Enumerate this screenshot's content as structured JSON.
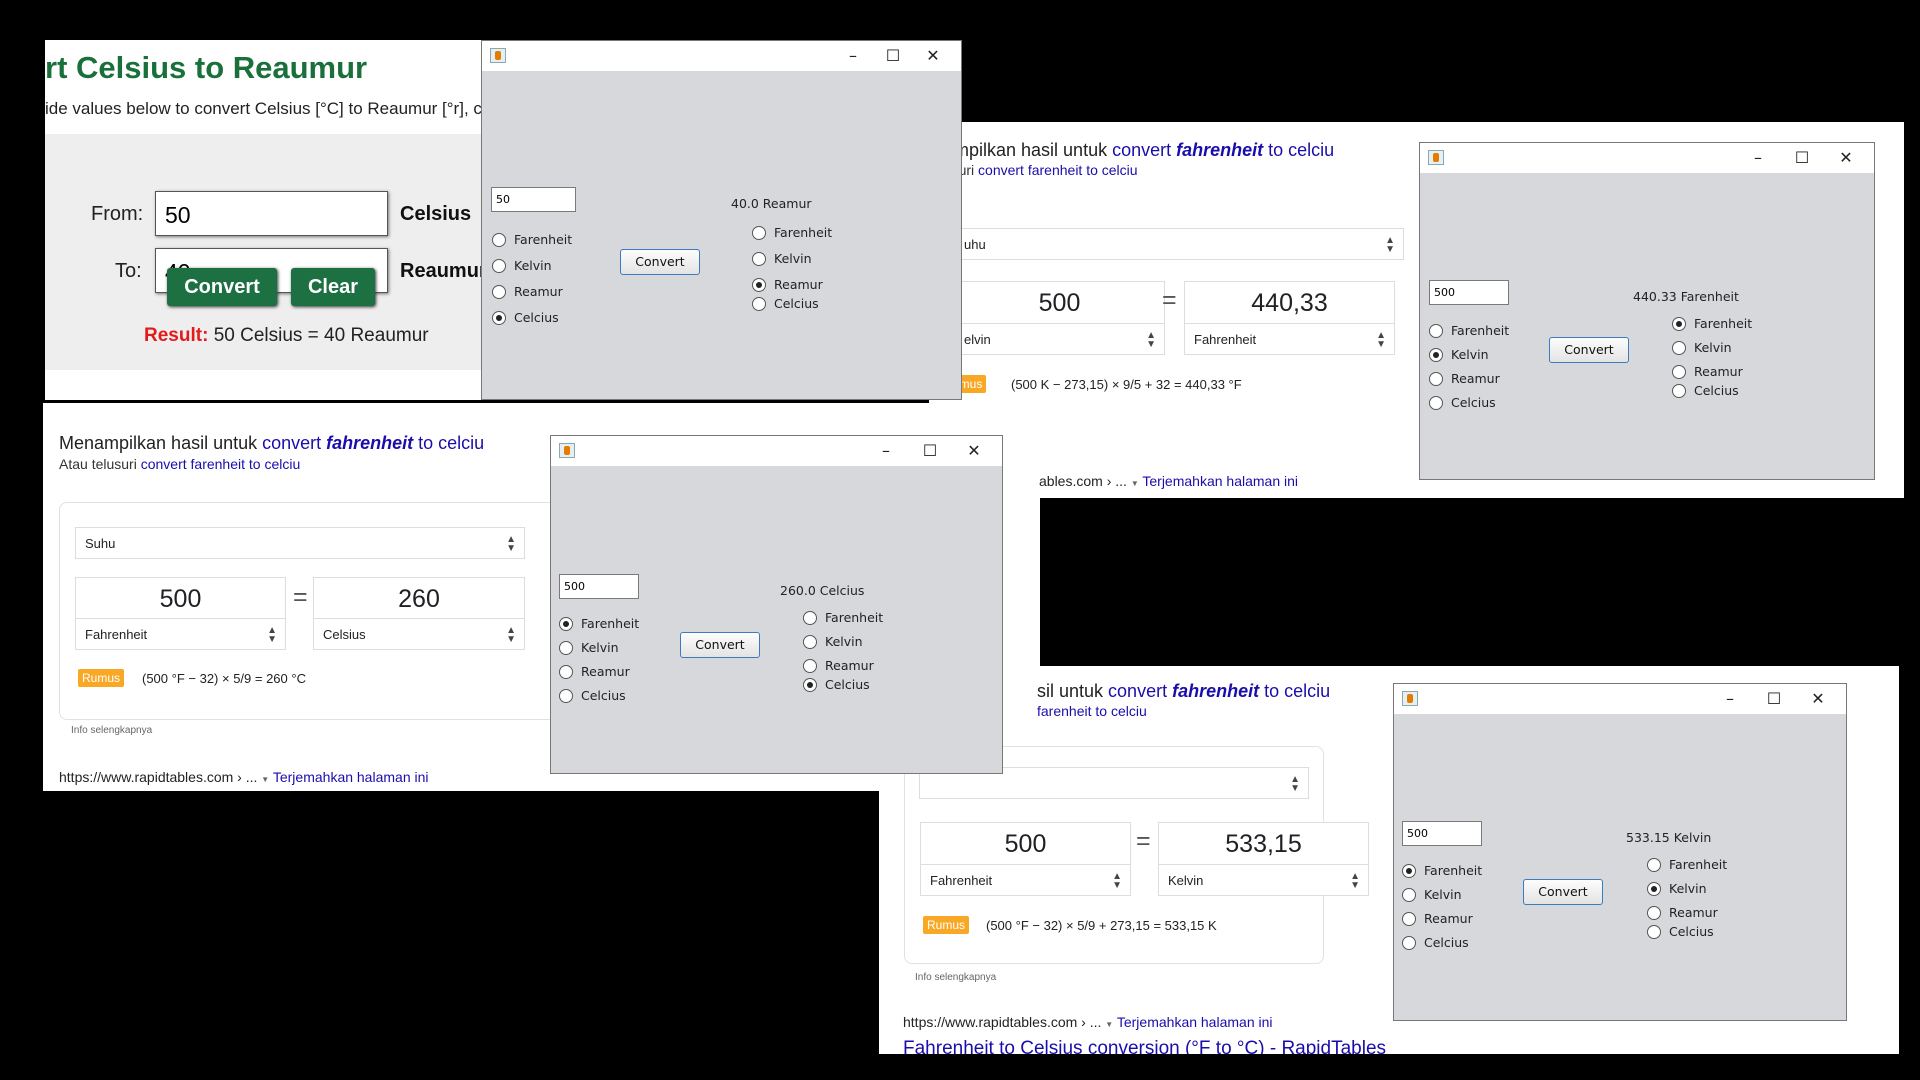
{
  "rapidtables": {
    "title": "rt Celsius to Reaumur",
    "subtitle": "ide values below to convert Celsius [°C] to Reaumur [°r], c",
    "from_label": "From:",
    "from_value": "50",
    "from_unit": "Celsius",
    "to_label": "To:",
    "to_value": "40",
    "to_unit": "Reaumur",
    "convert_label": "Convert",
    "clear_label": "Clear",
    "result_label": "Result:",
    "result_text": "50 Celsius = 40 Reaumur"
  },
  "google_left": {
    "head_prefix": "Menampilkan hasil untuk ",
    "head_link_a": "convert ",
    "head_link_b": "fahrenheit",
    "head_link_c": " to celciu",
    "sub_prefix": "Atau telusuri ",
    "sub_link": "convert farenheit to celciu",
    "category": "Suhu",
    "from_value": "500",
    "to_value": "260",
    "from_unit": "Fahrenheit",
    "to_unit": "Celsius",
    "rumus": "Rumus",
    "formula": "(500 °F − 32) × 5/9 = 260 °C",
    "info": "Info selengkapnya",
    "url": "https://www.rapidtables.com › ...",
    "translate": "Terjemahkan halaman ini"
  },
  "google_top_right": {
    "head_prefix": "mampilkan hasil untuk ",
    "head_link_a": "convert ",
    "head_link_b": "fahrenheit",
    "head_link_c": " to celciu",
    "sub_prefix": "telusuri ",
    "sub_link": "convert farenheit to celciu",
    "category": "uhu",
    "from_value": "500",
    "to_value": "440,33",
    "from_unit": "elvin",
    "to_unit": "Fahrenheit",
    "rumus": "umus",
    "formula": "(500 K − 273,15) × 9/5 + 32 = 440,33 °F",
    "url": "ables.com › ...",
    "translate": "Terjemahkan halaman ini"
  },
  "google_bottom_right": {
    "head_prefix": "sil untuk ",
    "head_link_a": "convert ",
    "head_link_b": "fahrenheit",
    "head_link_c": " to celciu",
    "sub_link": "farenheit to celciu",
    "from_value": "500",
    "to_value": "533,15",
    "from_unit": "Fahrenheit",
    "to_unit": "Kelvin",
    "rumus": "Rumus",
    "formula": "(500 °F − 32) × 5/9 + 273,15 = 533,15 K",
    "info": "Info selengkapnya",
    "url": "https://www.rapidtables.com › ...",
    "translate": "Terjemahkan halaman ini",
    "result_link": "Fahrenheit to Celsius conversion (°F to °C) - RapidTables"
  },
  "window_controls": {
    "minimize": "–",
    "maximize": "☐",
    "close": "✕"
  },
  "java_windows": [
    {
      "input": "50",
      "button": "Convert",
      "output": "40.0 Reamur",
      "left_options": [
        "Farenheit",
        "Kelvin",
        "Reamur",
        "Celcius"
      ],
      "left_selected": "Celcius",
      "right_options": [
        "Farenheit",
        "Kelvin",
        "Reamur",
        "Celcius"
      ],
      "right_selected": "Reamur"
    },
    {
      "input": "500",
      "button": "Convert",
      "output": "440.33 Farenheit",
      "left_options": [
        "Farenheit",
        "Kelvin",
        "Reamur",
        "Celcius"
      ],
      "left_selected": "Kelvin",
      "right_options": [
        "Farenheit",
        "Kelvin",
        "Reamur",
        "Celcius"
      ],
      "right_selected": "Farenheit"
    },
    {
      "input": "500",
      "button": "Convert",
      "output": "260.0 Celcius",
      "left_options": [
        "Farenheit",
        "Kelvin",
        "Reamur",
        "Celcius"
      ],
      "left_selected": "Farenheit",
      "right_options": [
        "Farenheit",
        "Kelvin",
        "Reamur",
        "Celcius"
      ],
      "right_selected": "Celcius"
    },
    {
      "input": "500",
      "button": "Convert",
      "output": "533.15 Kelvin",
      "left_options": [
        "Farenheit",
        "Kelvin",
        "Reamur",
        "Celcius"
      ],
      "left_selected": "Farenheit",
      "right_options": [
        "Farenheit",
        "Kelvin",
        "Reamur",
        "Celcius"
      ],
      "right_selected": "Kelvin"
    }
  ]
}
